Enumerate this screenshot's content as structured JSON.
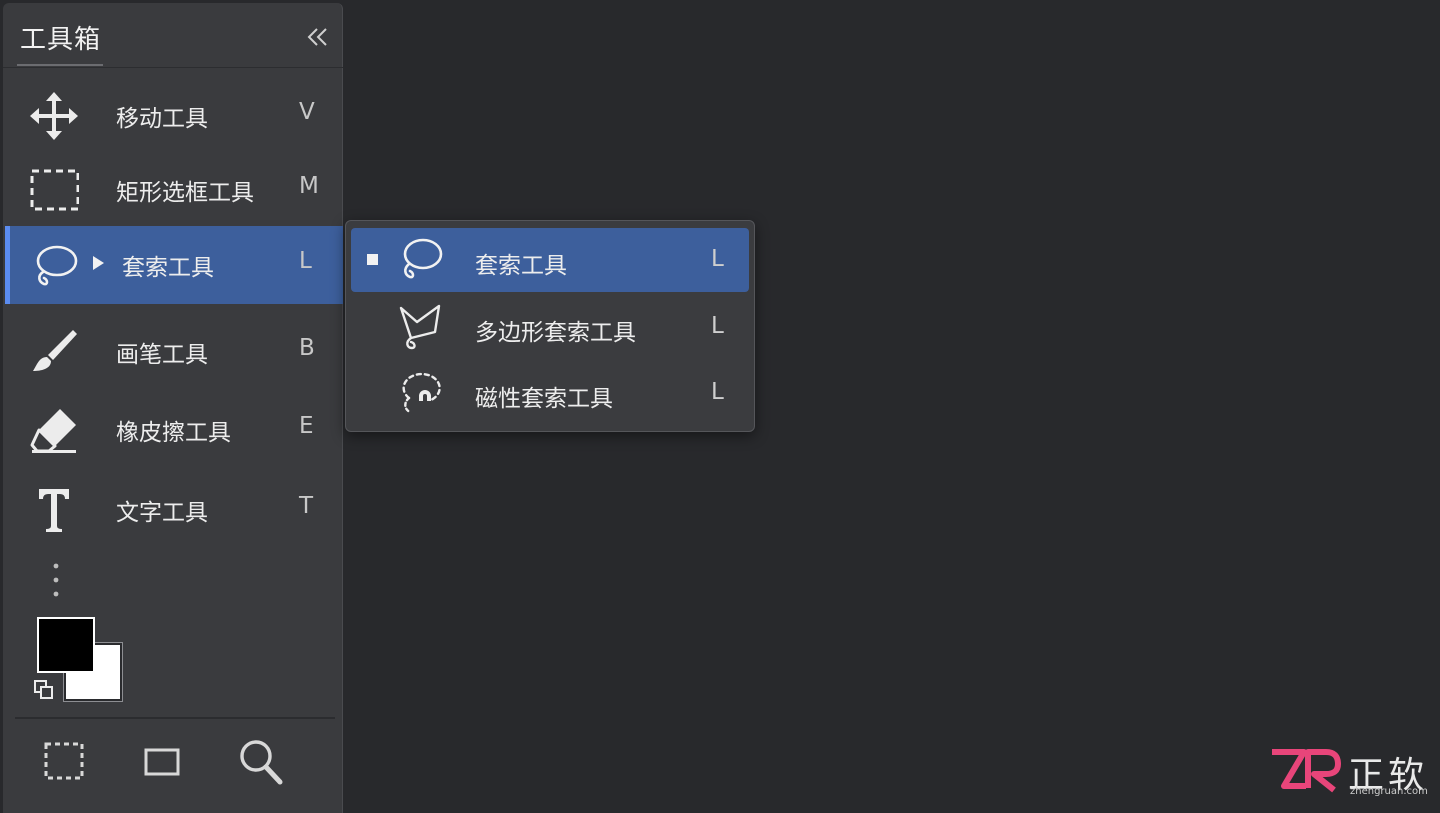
{
  "toolbox": {
    "title": "工具箱",
    "tools": [
      {
        "label": "移动工具",
        "key": "V",
        "icon": "move-icon"
      },
      {
        "label": "矩形选框工具",
        "key": "M",
        "icon": "rect-marquee-icon"
      },
      {
        "label": "套索工具",
        "key": "L",
        "icon": "lasso-icon",
        "active": true
      },
      {
        "label": "画笔工具",
        "key": "B",
        "icon": "brush-icon"
      },
      {
        "label": "橡皮擦工具",
        "key": "E",
        "icon": "eraser-icon"
      },
      {
        "label": "文字工具",
        "key": "T",
        "icon": "type-icon"
      }
    ],
    "foreground_color": "#000000",
    "background_color": "#ffffff",
    "bottom_icons": [
      "quick-mask-marquee-icon",
      "screen-mode-icon",
      "zoom-icon"
    ]
  },
  "flyout": {
    "items": [
      {
        "label": "套索工具",
        "key": "L",
        "icon": "lasso-icon",
        "selected": true
      },
      {
        "label": "多边形套索工具",
        "key": "L",
        "icon": "polygon-lasso-icon"
      },
      {
        "label": "磁性套索工具",
        "key": "L",
        "icon": "magnetic-lasso-icon"
      }
    ]
  },
  "watermark": {
    "brand_cn": "正软",
    "url": "zhengruan.com"
  },
  "colors": {
    "canvas": "#28292c",
    "panel": "#3a3b3e",
    "accent": "#3d5f9c",
    "accent_bar": "#5b8cf0",
    "logo_pink": "#e8457a"
  }
}
